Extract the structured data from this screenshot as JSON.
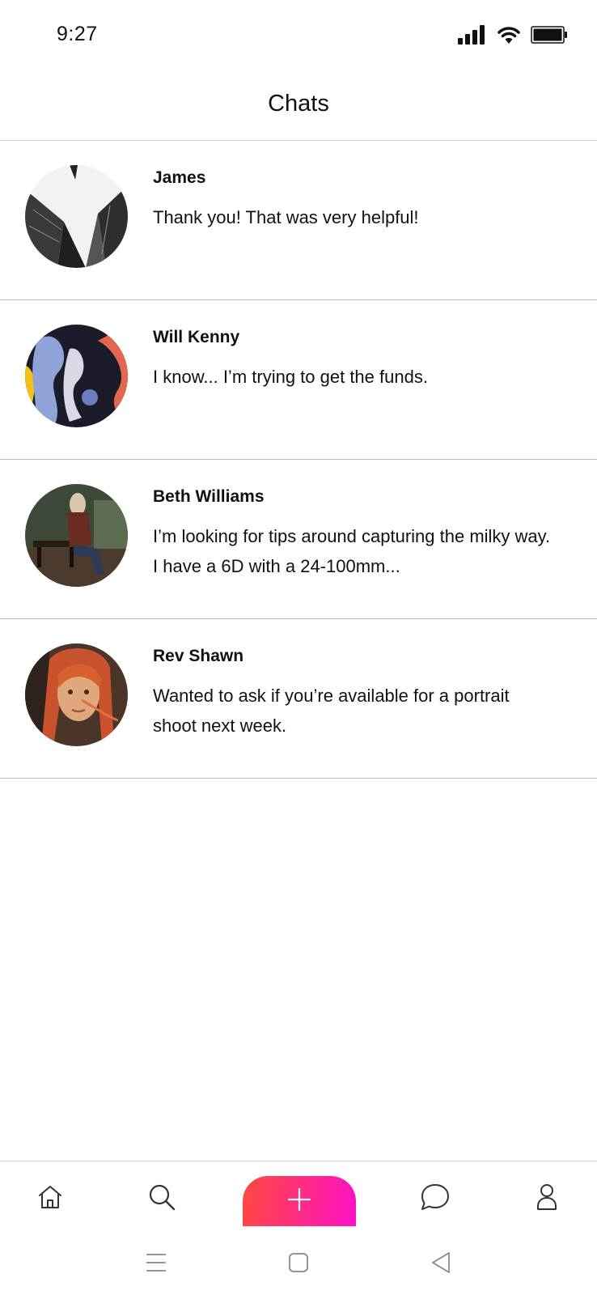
{
  "status_bar": {
    "time": "9:27",
    "icons": [
      "signal-icon",
      "wifi-icon",
      "battery-icon"
    ]
  },
  "header": {
    "title": "Chats"
  },
  "chats": [
    {
      "name": "James",
      "message": "Thank you! That was very helpful!",
      "avatar": "skyscrapers-photo"
    },
    {
      "name": "Will Kenny",
      "message": "I know... I’m trying to get the funds.",
      "avatar": "abstract-paint-photo"
    },
    {
      "name": "Beth Williams",
      "message": "I’m looking for tips around capturing the milky way. I have a 6D with a 24-100mm...",
      "avatar": "woman-on-bench-photo"
    },
    {
      "name": "Rev Shawn",
      "message": "Wanted to ask if you’re available for a portrait shoot next week.",
      "avatar": "red-hair-portrait-photo"
    }
  ],
  "bottom_nav": {
    "items": [
      "home-icon",
      "search-icon",
      "add-icon",
      "chat-icon",
      "profile-icon"
    ],
    "fab_gradient": [
      "#ff4a3d",
      "#ff2f7a",
      "#ff10c8"
    ]
  },
  "system_nav": {
    "items": [
      "menu-icon",
      "home-square-icon",
      "back-icon"
    ]
  }
}
